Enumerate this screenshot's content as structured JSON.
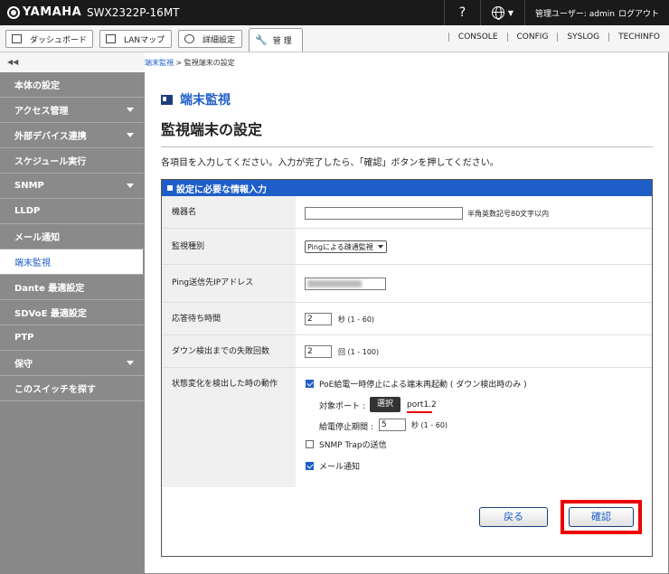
{
  "topbar": {
    "brand": "YAMAHA",
    "model": "SWX2322P-16MT",
    "help": "?",
    "user": "管理ユーザー: admin",
    "logout": "ログアウト"
  },
  "tabs": {
    "dashboard": "ダッシュボード",
    "lanmap": "LANマップ",
    "detail": "詳細設定",
    "admin": "管 理"
  },
  "right_links": [
    "CONSOLE",
    "CONFIG",
    "SYSLOG",
    "TECHINFO"
  ],
  "sidebar": {
    "collapse": "◀◀",
    "items": [
      {
        "label": "本体の設定",
        "arrow": false
      },
      {
        "label": "アクセス管理",
        "arrow": true
      },
      {
        "label": "外部デバイス連携",
        "arrow": true
      },
      {
        "label": "スケジュール実行",
        "arrow": false
      },
      {
        "label": "SNMP",
        "arrow": true
      },
      {
        "label": "LLDP",
        "arrow": false
      },
      {
        "label": "メール通知",
        "arrow": false
      },
      {
        "label": "端末監視",
        "arrow": false
      },
      {
        "label": "Dante 最適設定",
        "arrow": false
      },
      {
        "label": "SDVoE 最適設定",
        "arrow": false
      },
      {
        "label": "PTP",
        "arrow": false
      },
      {
        "label": "保守",
        "arrow": true
      },
      {
        "label": "このスイッチを探す",
        "arrow": false
      }
    ]
  },
  "breadcrumb": {
    "link": "端末監視",
    "sep": " > ",
    "current": "監視端末の設定"
  },
  "section_title": "端末監視",
  "page_title": "監視端末の設定",
  "instruction": "各項目を入力してください。入力が完了したら、「確認」ボタンを押してください。",
  "form": {
    "header": "設定に必要な情報入力",
    "device_name": {
      "label": "機器名",
      "value": "",
      "hint": "半角英数記号80文字以内"
    },
    "monitor_type": {
      "label": "監視種別",
      "value": "Pingによる疎通監視"
    },
    "ping_ip": {
      "label": "Ping送信先IPアドレス"
    },
    "response_wait": {
      "label": "応答待ち時間",
      "value": "2",
      "unit": "秒 (1 - 60)"
    },
    "fail_count": {
      "label": "ダウン検出までの失敗回数",
      "value": "2",
      "unit": "回 (1 - 100)"
    },
    "action": {
      "label": "状態変化を検出した時の動作",
      "poe_label": "PoE給電一時停止による端末再起動 ( ダウン検出時のみ )",
      "poe_checked": true,
      "target_port_label": "対象ポート :",
      "select_button": "選択",
      "port_value": "port1.2",
      "stop_period_label": "給電停止期間 :",
      "stop_period_value": "5",
      "stop_period_unit": "秒 (1 - 60)",
      "snmp_label": "SNMP Trapの送信",
      "snmp_checked": false,
      "mail_label": "メール通知",
      "mail_checked": true
    }
  },
  "buttons": {
    "back": "戻る",
    "confirm": "確認"
  }
}
